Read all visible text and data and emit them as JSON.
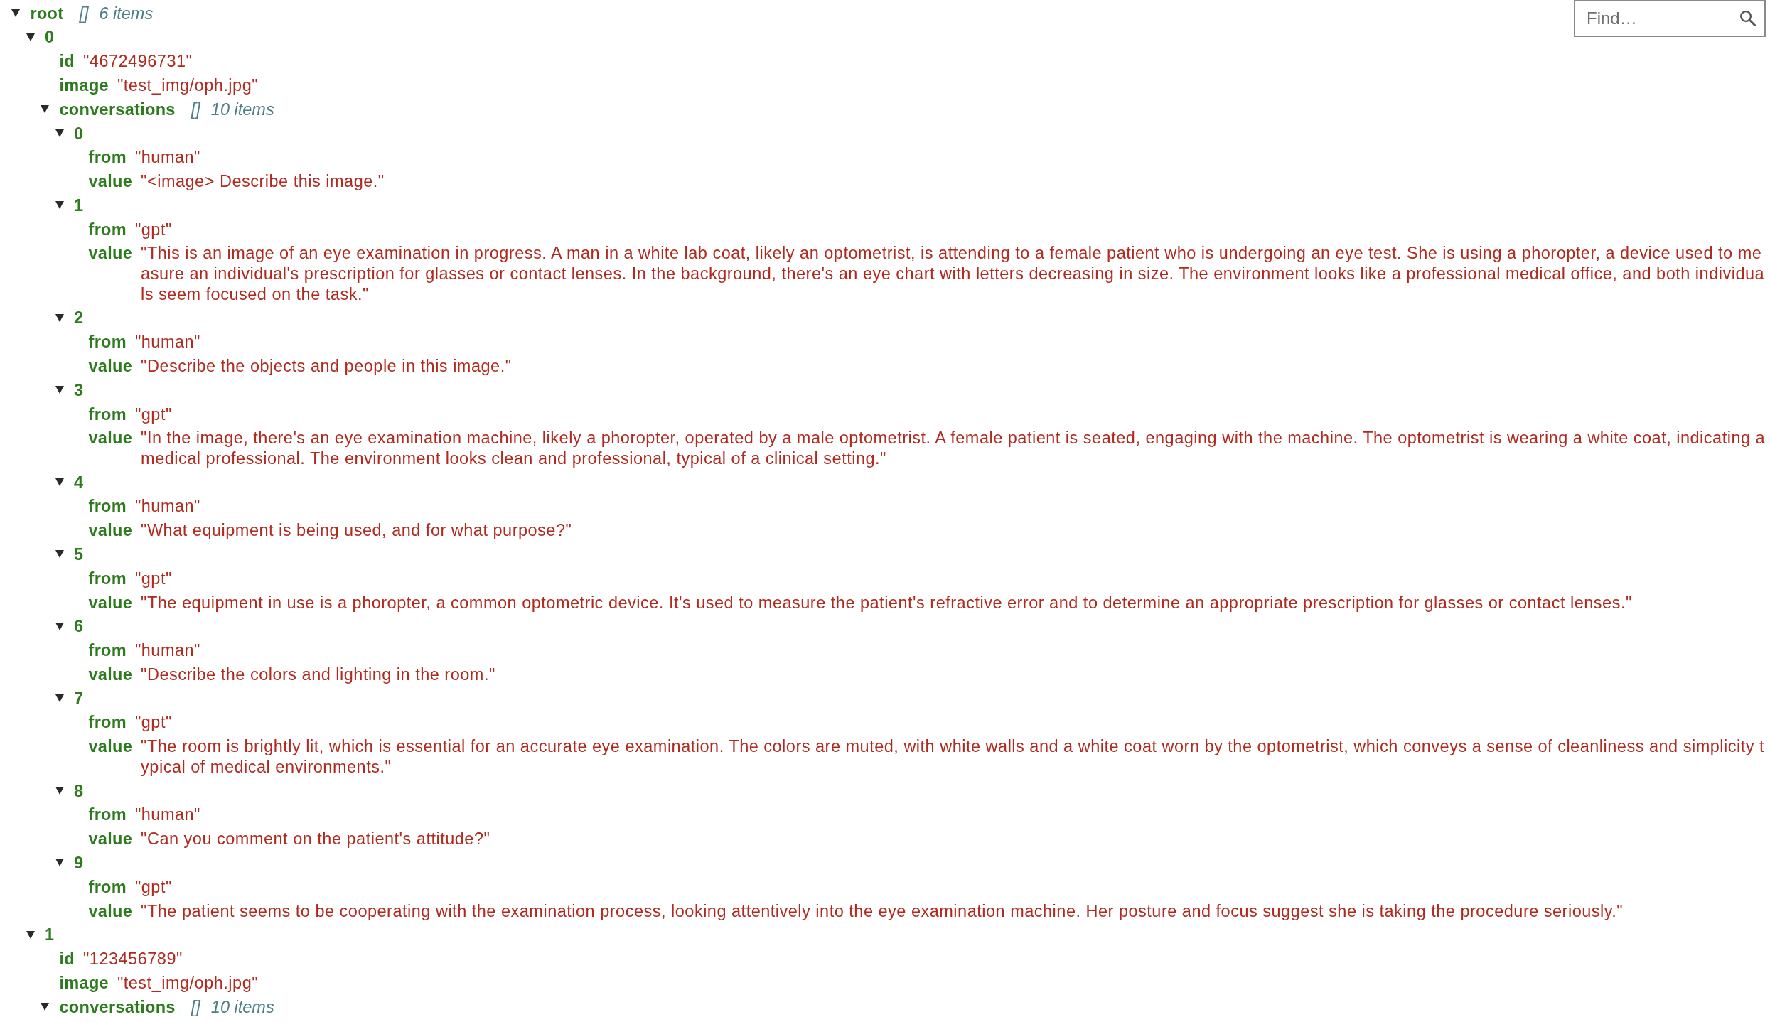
{
  "search": {
    "placeholder": "Find…"
  },
  "tree": {
    "key": "root",
    "kind": "array",
    "bracket": "[]",
    "summary": "6 items",
    "expanded": true,
    "children": [
      {
        "key": "0",
        "kind": "object",
        "expanded": true,
        "children": [
          {
            "key": "id",
            "kind": "string",
            "value": "\"4672496731\""
          },
          {
            "key": "image",
            "kind": "string",
            "value": "\"test_img/oph.jpg\""
          },
          {
            "key": "conversations",
            "kind": "array",
            "bracket": "[]",
            "summary": "10 items",
            "expanded": true,
            "children": [
              {
                "key": "0",
                "kind": "object",
                "expanded": true,
                "children": [
                  {
                    "key": "from",
                    "kind": "string",
                    "value": "\"human\""
                  },
                  {
                    "key": "value",
                    "kind": "string",
                    "value": "\"<image> Describe this image.\""
                  }
                ]
              },
              {
                "key": "1",
                "kind": "object",
                "expanded": true,
                "children": [
                  {
                    "key": "from",
                    "kind": "string",
                    "value": "\"gpt\""
                  },
                  {
                    "key": "value",
                    "kind": "string",
                    "value": "\"This is an image of an eye examination in progress. A man in a white lab coat, likely an optometrist, is attending to a female patient who is undergoing an eye test. She is using a phoropter, a device used to measure an individual's prescription for glasses or contact lenses. In the background, there's an eye chart with letters decreasing in size. The environment looks like a professional medical office, and both individuals seem focused on the task.\""
                  }
                ]
              },
              {
                "key": "2",
                "kind": "object",
                "expanded": true,
                "children": [
                  {
                    "key": "from",
                    "kind": "string",
                    "value": "\"human\""
                  },
                  {
                    "key": "value",
                    "kind": "string",
                    "value": "\"Describe the objects and people in this image.\""
                  }
                ]
              },
              {
                "key": "3",
                "kind": "object",
                "expanded": true,
                "children": [
                  {
                    "key": "from",
                    "kind": "string",
                    "value": "\"gpt\""
                  },
                  {
                    "key": "value",
                    "kind": "string",
                    "value": "\"In the image, there's an eye examination machine, likely a phoropter, operated by a male optometrist. A female patient is seated, engaging with the machine. The optometrist is wearing a white coat, indicating a medical professional. The environment looks clean and professional, typical of a clinical setting.\""
                  }
                ]
              },
              {
                "key": "4",
                "kind": "object",
                "expanded": true,
                "children": [
                  {
                    "key": "from",
                    "kind": "string",
                    "value": "\"human\""
                  },
                  {
                    "key": "value",
                    "kind": "string",
                    "value": "\"What equipment is being used, and for what purpose?\""
                  }
                ]
              },
              {
                "key": "5",
                "kind": "object",
                "expanded": true,
                "children": [
                  {
                    "key": "from",
                    "kind": "string",
                    "value": "\"gpt\""
                  },
                  {
                    "key": "value",
                    "kind": "string",
                    "value": "\"The equipment in use is a phoropter, a common optometric device. It's used to measure the patient's refractive error and to determine an appropriate prescription for glasses or contact lenses.\""
                  }
                ]
              },
              {
                "key": "6",
                "kind": "object",
                "expanded": true,
                "children": [
                  {
                    "key": "from",
                    "kind": "string",
                    "value": "\"human\""
                  },
                  {
                    "key": "value",
                    "kind": "string",
                    "value": "\"Describe the colors and lighting in the room.\""
                  }
                ]
              },
              {
                "key": "7",
                "kind": "object",
                "expanded": true,
                "children": [
                  {
                    "key": "from",
                    "kind": "string",
                    "value": "\"gpt\""
                  },
                  {
                    "key": "value",
                    "kind": "string",
                    "value": "\"The room is brightly lit, which is essential for an accurate eye examination. The colors are muted, with white walls and a white coat worn by the optometrist, which conveys a sense of cleanliness and simplicity typical of medical environments.\""
                  }
                ]
              },
              {
                "key": "8",
                "kind": "object",
                "expanded": true,
                "children": [
                  {
                    "key": "from",
                    "kind": "string",
                    "value": "\"human\""
                  },
                  {
                    "key": "value",
                    "kind": "string",
                    "value": "\"Can you comment on the patient's attitude?\""
                  }
                ]
              },
              {
                "key": "9",
                "kind": "object",
                "expanded": true,
                "children": [
                  {
                    "key": "from",
                    "kind": "string",
                    "value": "\"gpt\""
                  },
                  {
                    "key": "value",
                    "kind": "string",
                    "value": "\"The patient seems to be cooperating with the examination process, looking attentively into the eye examination machine. Her posture and focus suggest she is taking the procedure seriously.\""
                  }
                ]
              }
            ]
          }
        ]
      },
      {
        "key": "1",
        "kind": "object",
        "expanded": true,
        "children": [
          {
            "key": "id",
            "kind": "string",
            "value": "\"123456789\""
          },
          {
            "key": "image",
            "kind": "string",
            "value": "\"test_img/oph.jpg\""
          },
          {
            "key": "conversations",
            "kind": "array",
            "bracket": "[]",
            "summary": "10 items",
            "expanded": true
          }
        ]
      }
    ]
  }
}
